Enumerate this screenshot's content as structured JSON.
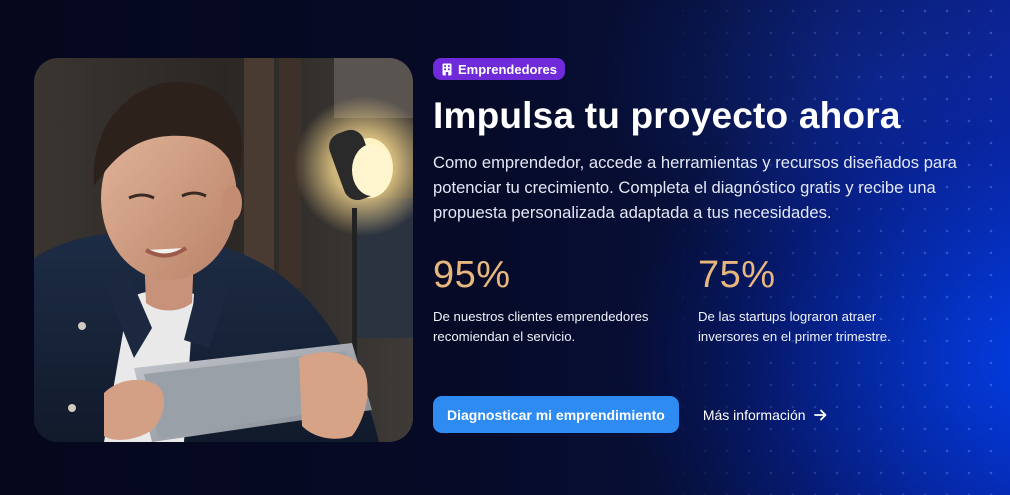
{
  "badge": {
    "icon": "building-icon",
    "label": "Emprendedores",
    "color": "#6f2bd9"
  },
  "hero": {
    "title": "Impulsa tu proyecto ahora",
    "description": "Como emprendedor, accede a herramientas y recursos diseñados para potenciar tu crecimiento. Completa el diagnóstico gratis y recibe una propuesta personalizada adaptada a tus necesidades.",
    "image": "man-holding-tablet-photo"
  },
  "stats": [
    {
      "value": "95%",
      "label": "De nuestros clientes emprendedores recomiendan el servicio."
    },
    {
      "value": "75%",
      "label": "De las startups lograron atraer inversores en el primer trimestre."
    }
  ],
  "actions": {
    "primary_label": "Diagnosticar mi emprendimiento",
    "secondary_label": "Más información",
    "secondary_icon": "arrow-right-icon"
  },
  "colors": {
    "accent": "#2d8bf2",
    "stat": "#e8b77e",
    "background": "#05081c"
  }
}
